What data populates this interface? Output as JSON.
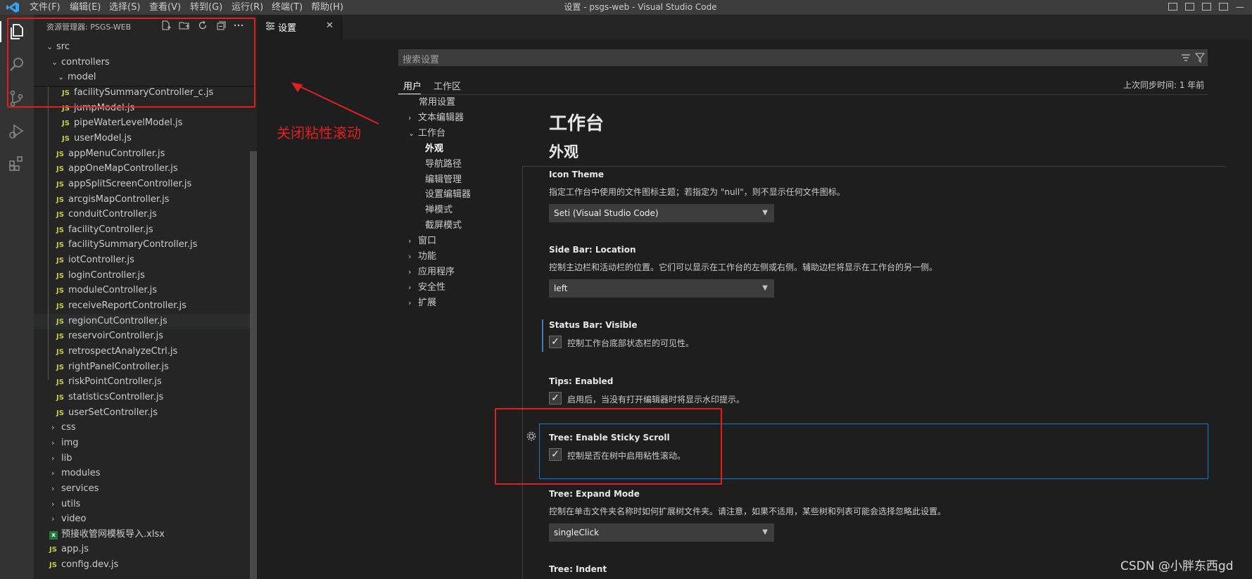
{
  "titlebar": {
    "menus": [
      "文件(F)",
      "编辑(E)",
      "选择(S)",
      "查看(V)",
      "转到(G)",
      "运行(R)",
      "终端(T)",
      "帮助(H)"
    ],
    "window_title": "设置 - psgs-web - Visual Studio Code"
  },
  "activity_bar": {
    "icons": [
      "explorer-icon",
      "search-icon",
      "source-control-icon",
      "run-debug-icon",
      "extensions-icon"
    ]
  },
  "sidebar": {
    "title": "资源管理器: PSGS-WEB",
    "actions": [
      "new-file-icon",
      "new-folder-icon",
      "refresh-icon",
      "collapse-all-icon",
      "more-icon"
    ],
    "tree": [
      {
        "label": "src",
        "type": "folder",
        "expanded": true
      },
      {
        "label": "controllers",
        "type": "folder",
        "expanded": true
      },
      {
        "label": "model",
        "type": "folder",
        "expanded": true
      },
      {
        "label": "facilitySummaryController_c.js",
        "type": "js"
      },
      {
        "label": "jumpModel.js",
        "type": "js"
      },
      {
        "label": "pipeWaterLevelModel.js",
        "type": "js"
      },
      {
        "label": "userModel.js",
        "type": "js"
      },
      {
        "label": "appMenuController.js",
        "type": "js"
      },
      {
        "label": "appOneMapController.js",
        "type": "js"
      },
      {
        "label": "appSplitScreenController.js",
        "type": "js"
      },
      {
        "label": "arcgisMapController.js",
        "type": "js"
      },
      {
        "label": "conduitController.js",
        "type": "js"
      },
      {
        "label": "facilityController.js",
        "type": "js"
      },
      {
        "label": "facilitySummaryController.js",
        "type": "js"
      },
      {
        "label": "iotController.js",
        "type": "js"
      },
      {
        "label": "loginController.js",
        "type": "js"
      },
      {
        "label": "moduleController.js",
        "type": "js"
      },
      {
        "label": "receiveReportController.js",
        "type": "js"
      },
      {
        "label": "regionCutController.js",
        "type": "js"
      },
      {
        "label": "reservoirController.js",
        "type": "js"
      },
      {
        "label": "retrospectAnalyzeCtrl.js",
        "type": "js"
      },
      {
        "label": "rightPanelController.js",
        "type": "js"
      },
      {
        "label": "riskPointController.js",
        "type": "js"
      },
      {
        "label": "statisticsController.js",
        "type": "js"
      },
      {
        "label": "userSetController.js",
        "type": "js"
      },
      {
        "label": "css",
        "type": "folder",
        "expanded": false
      },
      {
        "label": "img",
        "type": "folder",
        "expanded": false
      },
      {
        "label": "lib",
        "type": "folder",
        "expanded": false
      },
      {
        "label": "modules",
        "type": "folder",
        "expanded": false
      },
      {
        "label": "services",
        "type": "folder",
        "expanded": false
      },
      {
        "label": "utils",
        "type": "folder",
        "expanded": false
      },
      {
        "label": "video",
        "type": "folder",
        "expanded": false
      },
      {
        "label": "预接收管网模板导入.xlsx",
        "type": "xlsx"
      },
      {
        "label": "app.js",
        "type": "js"
      },
      {
        "label": "config.dev.js",
        "type": "js"
      }
    ]
  },
  "editor": {
    "tab_label": "设置",
    "tab_icon": "settings-icon",
    "close_glyph": "✕"
  },
  "settings": {
    "search_placeholder": "搜索设置",
    "scope_tabs": [
      "用户",
      "工作区"
    ],
    "sync_status": "上次同步时间: 1 年前",
    "toc": [
      {
        "label": "常用设置",
        "chevron": "",
        "bold": false
      },
      {
        "label": "文本编辑器",
        "chevron": "›",
        "bold": false
      },
      {
        "label": "工作台",
        "chevron": "⌄",
        "bold": false
      },
      {
        "label": "外观",
        "chevron": "",
        "bold": true,
        "child": true
      },
      {
        "label": "导航路径",
        "chevron": "",
        "bold": false,
        "child": true
      },
      {
        "label": "编辑管理",
        "chevron": "",
        "bold": false,
        "child": true
      },
      {
        "label": "设置编辑器",
        "chevron": "",
        "bold": false,
        "child": true
      },
      {
        "label": "禅模式",
        "chevron": "",
        "bold": false,
        "child": true
      },
      {
        "label": "截屏模式",
        "chevron": "",
        "bold": false,
        "child": true
      },
      {
        "label": "窗口",
        "chevron": "›",
        "bold": false
      },
      {
        "label": "功能",
        "chevron": "›",
        "bold": false
      },
      {
        "label": "应用程序",
        "chevron": "›",
        "bold": false
      },
      {
        "label": "安全性",
        "chevron": "›",
        "bold": false
      },
      {
        "label": "扩展",
        "chevron": "›",
        "bold": false
      }
    ],
    "section_title": "工作台",
    "subsection_title": "外观",
    "items": {
      "icon_theme": {
        "title_bold": "Icon Theme",
        "desc": "指定工作台中使用的文件图标主题；若指定为 \"null\"，则不显示任何文件图标。",
        "value": "Seti (Visual Studio Code)"
      },
      "sidebar_location": {
        "title_prefix": "Side Bar: ",
        "title_bold": "Location",
        "desc": "控制主边栏和活动栏的位置。它们可以显示在工作台的左侧或右侧。辅助边栏将显示在工作台的另一侧。",
        "value": "left"
      },
      "statusbar_visible": {
        "title_prefix": "Status Bar: ",
        "title_bold": "Visible",
        "desc": "控制工作台底部状态栏的可见性。",
        "checked": true
      },
      "tips_enabled": {
        "title_prefix": "Tips: ",
        "title_bold": "Enabled",
        "desc": "启用后，当没有打开编辑器时将显示水印提示。",
        "checked": true
      },
      "tree_sticky": {
        "title_prefix": "Tree: ",
        "title_bold": "Enable Sticky Scroll",
        "desc": "控制是否在树中启用粘性滚动。",
        "checked": true
      },
      "tree_expand": {
        "title_prefix": "Tree: ",
        "title_bold": "Expand Mode",
        "desc": "控制在单击文件夹名称时如何扩展树文件夹。请注意，如果不适用，某些树和列表可能会选择忽略此设置。",
        "value": "singleClick"
      },
      "tree_indent": {
        "title_prefix": "Tree: ",
        "title_bold": "Indent"
      }
    }
  },
  "annotation": {
    "text": "关闭粘性滚动",
    "color": "#e02020"
  },
  "watermark": "CSDN @小胖东西gd",
  "colors": {
    "accent_blue": "#007fd4",
    "js_yellow": "#cbcb41",
    "background": "#1e1e1e"
  }
}
